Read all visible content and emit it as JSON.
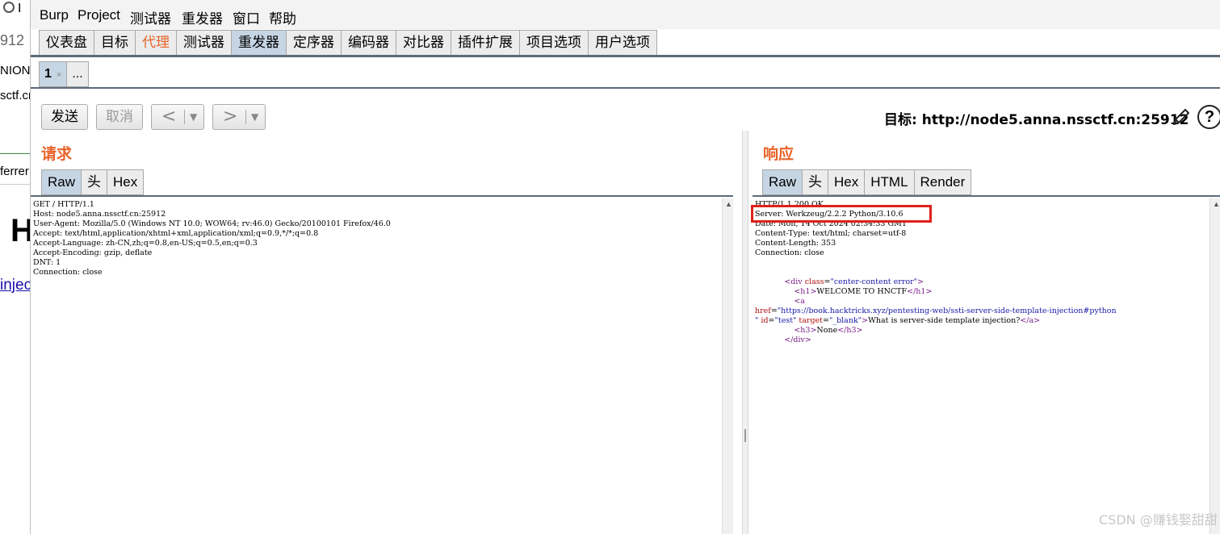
{
  "background_page": {
    "fragments": [
      "I",
      "912",
      "NION",
      "sctf.cr",
      "ferrer",
      "H",
      "injec"
    ]
  },
  "menubar": {
    "items": [
      "Burp",
      "Project",
      "测试器",
      "重发器",
      "窗口",
      "帮助"
    ]
  },
  "main_tabs": [
    "仪表盘",
    "目标",
    "代理",
    "测试器",
    "重发器",
    "定序器",
    "编码器",
    "对比器",
    "插件扩展",
    "项目选项",
    "用户选项"
  ],
  "sub_tabs": {
    "tab_label": "1",
    "close_glyph": "×",
    "more_label": "..."
  },
  "toolbar": {
    "send_label": "发送",
    "cancel_label": "取消",
    "back_glyph": "<",
    "forward_glyph": ">",
    "dropdown_glyph": "▼"
  },
  "target": {
    "label": "目标: http://node5.anna.nssctf.cn:25912"
  },
  "icons": {
    "edit": "pencil-icon",
    "help": "?"
  },
  "request": {
    "title": "请求",
    "tabs": [
      "Raw",
      "头",
      "Hex"
    ],
    "lines": [
      "GET / HTTP/1.1",
      "Host: node5.anna.nssctf.cn:25912",
      "User-Agent: Mozilla/5.0 (Windows NT 10.0; WOW64; rv:46.0) Gecko/20100101 Firefox/46.0",
      "Accept: text/html,application/xhtml+xml,application/xml;q=0.9,*/*;q=0.8",
      "Accept-Language: zh-CN,zh;q=0.8,en-US;q=0.5,en;q=0.3",
      "Accept-Encoding: gzip, deflate",
      "DNT: 1",
      "Connection: close"
    ]
  },
  "response": {
    "title": "响应",
    "tabs": [
      "Raw",
      "头",
      "Hex",
      "HTML",
      "Render"
    ],
    "headers": [
      "HTTP/1.1 200 OK",
      "Server: Werkzeug/2.2.2 Python/3.10.6",
      "Date: Mon, 14 Oct 2024 02:34:33 GMT",
      "Content-Type: text/html; charset=utf-8",
      "Content-Length: 353",
      "Connection: close"
    ],
    "body": {
      "div_class": "center-content error",
      "h1_text": "WELCOME TO HNCTF",
      "href": "https://book.hacktricks.xyz/pentesting-web/ssti-server-side-template-injection#python",
      "a_id": "test",
      "a_target": "_blank",
      "a_text": "What is server-side template injection?",
      "h3_text": "None"
    }
  },
  "watermark": "CSDN @赚钱娶甜甜",
  "colors": {
    "accent_orange": "#e8632a",
    "active_tab": "#c6d5e3",
    "highlight_red": "#e0201a"
  }
}
